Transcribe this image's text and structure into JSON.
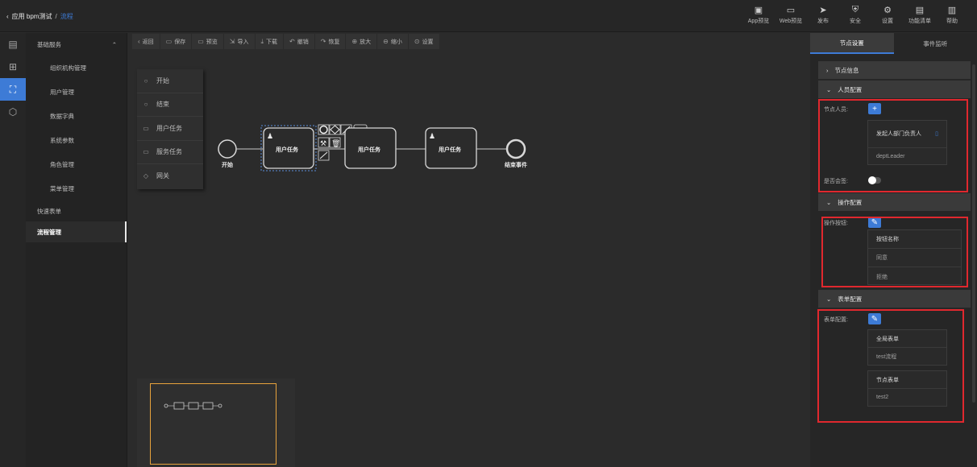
{
  "breadcrumb": {
    "back": "‹",
    "app": "应用 bpm测试",
    "sep": "/",
    "current": "流程"
  },
  "top_actions": [
    {
      "label": "App预览",
      "icon": "app-preview-icon",
      "glyph": "▣"
    },
    {
      "label": "Web预览",
      "icon": "web-preview-icon",
      "glyph": "▭"
    },
    {
      "label": "发布",
      "icon": "publish-icon",
      "glyph": "➤"
    },
    {
      "label": "安全",
      "icon": "security-icon",
      "glyph": "⛨"
    },
    {
      "label": "设置",
      "icon": "settings-icon",
      "glyph": "⚙"
    },
    {
      "label": "功能清单",
      "icon": "function-list-icon",
      "glyph": "▤"
    },
    {
      "label": "帮助",
      "icon": "help-icon",
      "glyph": "▥"
    }
  ],
  "rail": [
    "page-icon",
    "apps-icon",
    "flow-icon",
    "cube-icon"
  ],
  "menu": {
    "group": "基础服务",
    "items": [
      "组织机构管理",
      "用户管理",
      "数据字典",
      "系统参数",
      "角色管理",
      "菜单管理"
    ],
    "subs": [
      "快速表单",
      "流程管理"
    ]
  },
  "toolbar": [
    {
      "label": "返回",
      "glyph": "‹"
    },
    {
      "label": "保存",
      "glyph": "▭"
    },
    {
      "label": "预览",
      "glyph": "▭"
    },
    {
      "label": "导入",
      "glyph": "⇲"
    },
    {
      "label": "下载",
      "glyph": "⤓"
    },
    {
      "label": "撤销",
      "glyph": "↶"
    },
    {
      "label": "恢复",
      "glyph": "↷"
    },
    {
      "label": "放大",
      "glyph": "⊕"
    },
    {
      "label": "缩小",
      "glyph": "⊖"
    },
    {
      "label": "设置",
      "glyph": "⊙"
    }
  ],
  "palette": [
    {
      "label": "开始",
      "glyph": "○"
    },
    {
      "label": "结束",
      "glyph": "○"
    },
    {
      "label": "用户任务",
      "glyph": "▭"
    },
    {
      "label": "服务任务",
      "glyph": "▭"
    },
    {
      "label": "网关",
      "glyph": "◇"
    }
  ],
  "diagram": {
    "start_label": "开始",
    "task_label": "用户任务",
    "end_label": "结束事件"
  },
  "panel": {
    "tabs": [
      "节点设置",
      "事件监听"
    ],
    "node_info": "节点信息",
    "people_section": "人员配置",
    "node_people_label": "节点人员:",
    "add_glyph": "+",
    "assignee_name": "发起人部门负责人",
    "assignee_id": "deptLeader",
    "countersign_label": "是否会签:",
    "countersign_on": true,
    "ops_section": "操作配置",
    "ops_label": "操作按钮:",
    "edit_glyph": "✎",
    "ops_header": "按钮名称",
    "ops_items": [
      "同意",
      "拒绝"
    ],
    "form_section": "表单配置",
    "form_label": "表单配置:",
    "global_form_title": "全局表单",
    "global_form_value": "test流程",
    "node_form_title": "节点表单",
    "node_form_value": "test2"
  }
}
